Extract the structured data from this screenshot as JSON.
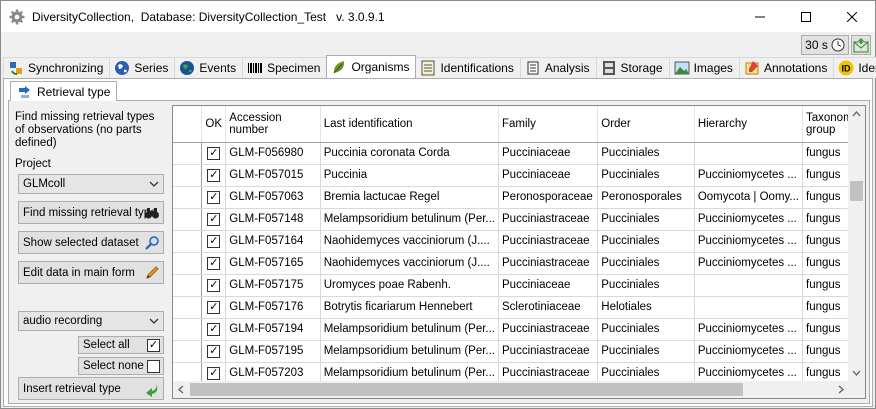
{
  "titlebar": {
    "title": "DiversityCollection,  Database: DiversityCollection_Test   v. 3.0.9.1",
    "icon": "gear-icon"
  },
  "toolbar": {
    "timer_label": "30 s"
  },
  "tabs": [
    {
      "label": "Synchronizing",
      "icon": "sync-icon",
      "color": "#2a7d2a"
    },
    {
      "label": "Series",
      "icon": "globe-icon",
      "color": "#1a4fa0"
    },
    {
      "label": "Events",
      "icon": "globe-icon",
      "color": "#1a8a3a"
    },
    {
      "label": "Specimen",
      "icon": "barcode-icon",
      "color": "#000000"
    },
    {
      "label": "Organisms",
      "icon": "leaf-icon",
      "color": "#5c8a2a",
      "active": true
    },
    {
      "label": "Identifications",
      "icon": "list-icon",
      "color": "#6a7a2a"
    },
    {
      "label": "Analysis",
      "icon": "scroll-icon",
      "color": "#444444"
    },
    {
      "label": "Storage",
      "icon": "cabinet-icon",
      "color": "#444444"
    },
    {
      "label": "Images",
      "icon": "image-icon",
      "color": "#2a7a3a"
    },
    {
      "label": "Annotations",
      "icon": "note-icon",
      "color": "#c08a00"
    },
    {
      "label": "Identifier",
      "icon": "id-icon",
      "color": "#e0a800"
    }
  ],
  "subtab": {
    "label": "Retrieval type"
  },
  "left": {
    "description": "Find missing retrieval types of observations (no parts defined)",
    "project_label": "Project",
    "project_value": "GLMcoll",
    "btn_find": "Find missing retrieval type",
    "btn_show": "Show selected dataset",
    "btn_edit": "Edit data in main form",
    "retrieval_value": "audio recording",
    "select_all": "Select all",
    "select_none": "Select none",
    "btn_insert": "Insert retrieval type"
  },
  "grid": {
    "columns": [
      "OK",
      "Accession number",
      "Last identification",
      "Family",
      "Order",
      "Hierarchy",
      "Taxonomic group"
    ],
    "rows": [
      {
        "ok": true,
        "accession": "GLM-F056980",
        "ident": "Puccinia coronata Corda",
        "family": "Pucciniaceae",
        "order": "Pucciniales",
        "hierarchy": "",
        "group": "fungus"
      },
      {
        "ok": true,
        "accession": "GLM-F057015",
        "ident": "Puccinia",
        "family": "Pucciniaceae",
        "order": "Pucciniales",
        "hierarchy": "Pucciniomycetes ...",
        "group": "fungus"
      },
      {
        "ok": true,
        "accession": "GLM-F057063",
        "ident": "Bremia lactucae Regel",
        "family": "Peronosporaceae",
        "order": "Peronosporales",
        "hierarchy": "Oomycota | Oomy...",
        "group": "fungus"
      },
      {
        "ok": true,
        "accession": "GLM-F057148",
        "ident": "Melampsoridium betulinum (Per...",
        "family": "Pucciniastraceae",
        "order": "Pucciniales",
        "hierarchy": "Pucciniomycetes ...",
        "group": "fungus"
      },
      {
        "ok": true,
        "accession": "GLM-F057164",
        "ident": "Naohidemyces vacciniorum (J....",
        "family": "Pucciniastraceae",
        "order": "Pucciniales",
        "hierarchy": "Pucciniomycetes ...",
        "group": "fungus"
      },
      {
        "ok": true,
        "accession": "GLM-F057165",
        "ident": "Naohidemyces vacciniorum (J....",
        "family": "Pucciniastraceae",
        "order": "Pucciniales",
        "hierarchy": "Pucciniomycetes ...",
        "group": "fungus"
      },
      {
        "ok": true,
        "accession": "GLM-F057175",
        "ident": "Uromyces poae Rabenh.",
        "family": "Pucciniaceae",
        "order": "Pucciniales",
        "hierarchy": "",
        "group": "fungus"
      },
      {
        "ok": true,
        "accession": "GLM-F057176",
        "ident": "Botrytis ficariarum Hennebert",
        "family": "Sclerotiniaceae",
        "order": "Helotiales",
        "hierarchy": "",
        "group": "fungus"
      },
      {
        "ok": true,
        "accession": "GLM-F057194",
        "ident": "Melampsoridium betulinum (Per...",
        "family": "Pucciniastraceae",
        "order": "Pucciniales",
        "hierarchy": "Pucciniomycetes ...",
        "group": "fungus"
      },
      {
        "ok": true,
        "accession": "GLM-F057195",
        "ident": "Melampsoridium betulinum (Per...",
        "family": "Pucciniastraceae",
        "order": "Pucciniales",
        "hierarchy": "Pucciniomycetes ...",
        "group": "fungus"
      },
      {
        "ok": true,
        "accession": "GLM-F057203",
        "ident": "Melampsoridium betulinum (Per...",
        "family": "Pucciniastraceae",
        "order": "Pucciniales",
        "hierarchy": "Pucciniomycetes ...",
        "group": "fungus"
      }
    ]
  }
}
